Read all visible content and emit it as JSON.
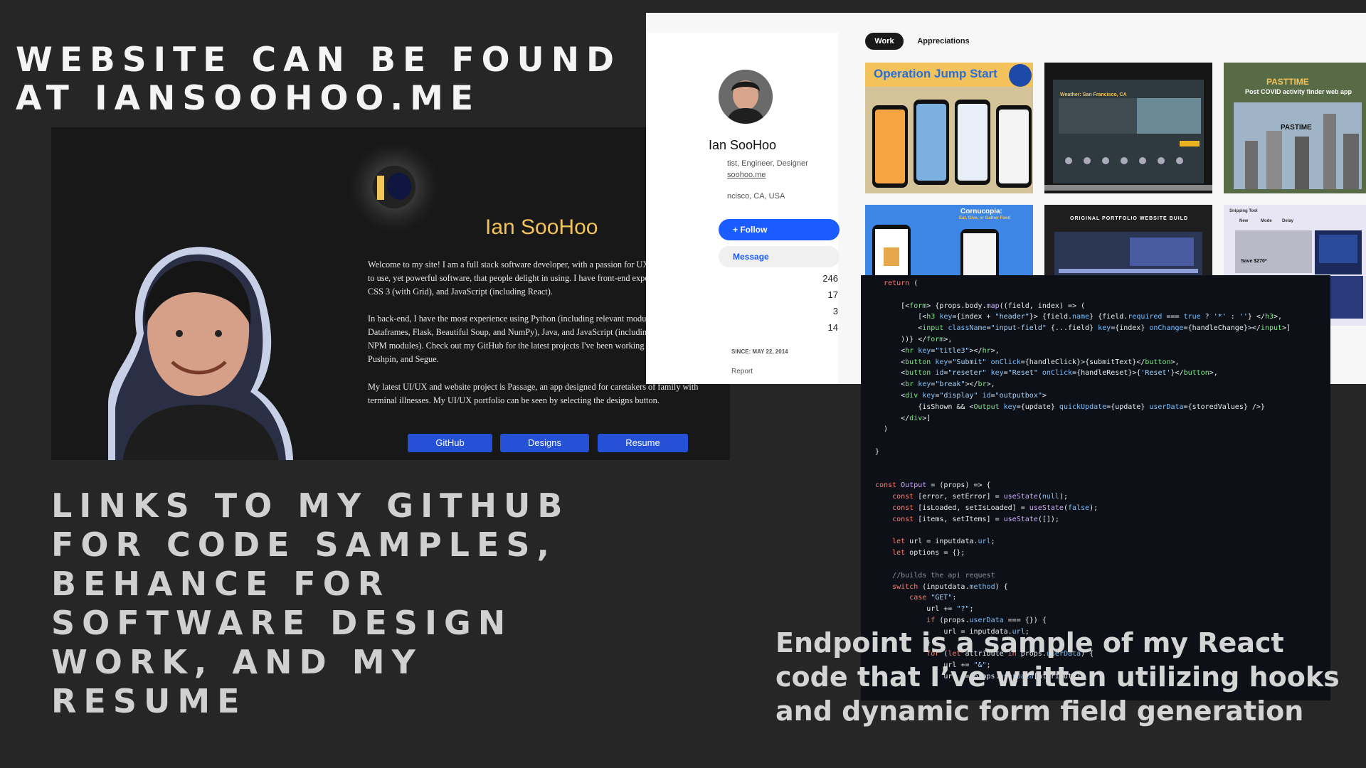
{
  "headline_top": "Website can be found at iansoohoo.me",
  "headline_links": "Links to my GitHub for code samples, Behance for software design work, and my resume",
  "caption": "Endpoint is a sample of my React code that I’ve written utilizing hooks and dynamic form field generation",
  "site": {
    "name": "Ian SooHoo",
    "para1": "Welcome to my site! I am a full stack software developer, with a passion for UX. I love to build easy to use, yet powerful software, that people delight in using. I have front-end experience in HTML 5, CSS 3 (with Grid), and JavaScript (including React).",
    "para2": "In back-end, I have the most experience using Python (including relevant modules such as Pandas Dataframes, Flask, Beautiful Soup, and NumPy), Java, and JavaScript (including NodeJS and various NPM modules). Check out my GitHub for the latest projects I've been working on including Pastime, Pushpin, and Segue.",
    "para3": "My latest UI/UX and website project is Passage, an app designed for caretakers of family with terminal illnesses. My UI/UX portfolio can be seen by selecting the designs button.",
    "buttons": [
      "GitHub",
      "Designs",
      "Resume"
    ]
  },
  "behance": {
    "name": "Ian SooHoo",
    "role": "tist, Engineer, Designer",
    "url": "soohoo.me",
    "location": "ncisco, CA, USA",
    "follow": "Follow",
    "message": "Message",
    "stats": [
      "246",
      "17",
      "3",
      "14"
    ],
    "since": "SINCE: MAY 22, 2014",
    "report": "Report",
    "tabs": [
      "Work",
      "Appreciations"
    ],
    "cards": {
      "jump": "Operation Jump Start",
      "pasttime_title": "PASTTIME",
      "pasttime_sub": "Post COVID activity finder web app",
      "pastime_label": "PASTIME",
      "cornucopia": "Cornucopia:",
      "cornucopia_sub": "Eat, Give, or Gather Food",
      "portfolio": "ORIGINAL PORTFOLIO WEBSITE BUILD",
      "weather": "Weather: San Francisco, CA",
      "save": "Save $270*",
      "snipping": "Snipping Tool",
      "new": "New",
      "mode": "Mode",
      "delay": "Delay"
    }
  },
  "colors": {
    "accent_blue": "#1a5cff",
    "gold": "#f2c35a",
    "background": "#262626"
  }
}
